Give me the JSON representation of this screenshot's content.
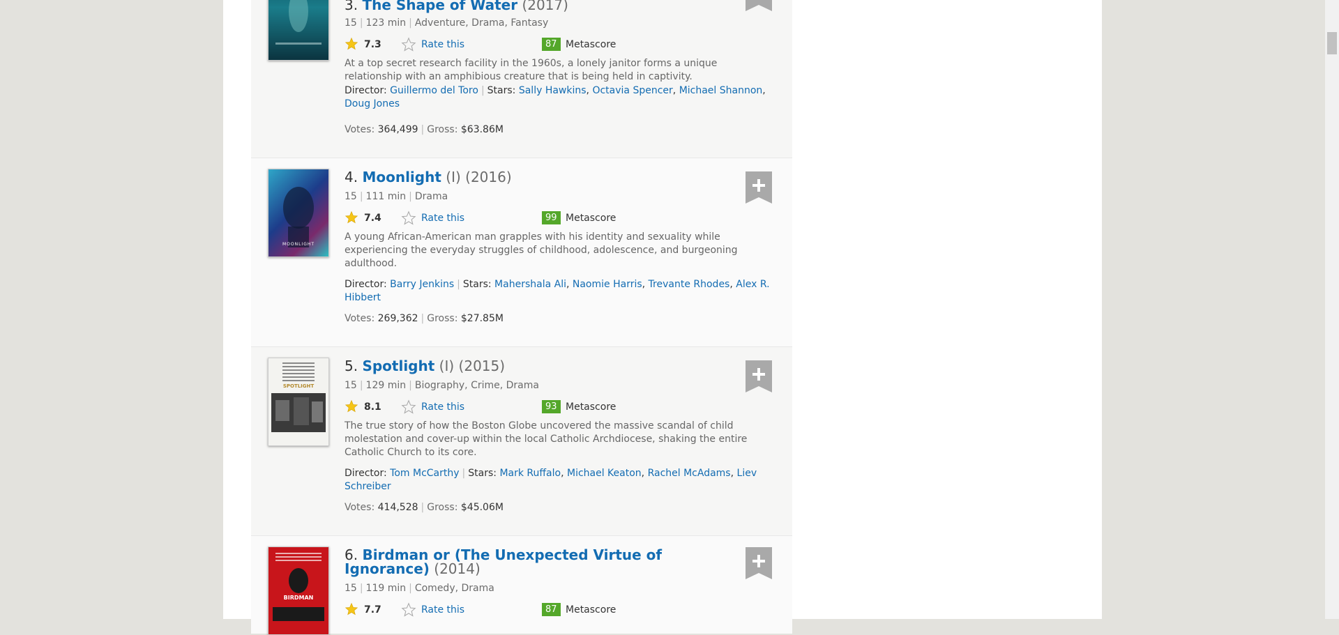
{
  "colors": {
    "link": "#136cb2",
    "metascore_green": "#54a72a",
    "page_bg": "#e3e2dd"
  },
  "movies": [
    {
      "index": "3.",
      "title": "The Shape of Water",
      "year": "(2017)",
      "extra": "",
      "cert": "15",
      "runtime": "123 min",
      "genres": "Adventure, Drama, Fantasy",
      "rating": "7.3",
      "rate_this": "Rate this",
      "metascore": "87",
      "metascore_label": "Metascore",
      "description": "At a top secret research facility in the 1960s, a lonely janitor forms a unique relationship with an amphibious creature that is being held in captivity.",
      "director_label": "Director:",
      "director": "Guillermo del Toro",
      "stars_label": "Stars:",
      "stars": [
        "Sally Hawkins",
        "Octavia Spencer",
        "Michael Shannon",
        "Doug Jones"
      ],
      "votes_label": "Votes:",
      "votes": "364,499",
      "gross_label": "Gross:",
      "gross": "$63.86M"
    },
    {
      "index": "4.",
      "title": "Moonlight",
      "year": "(2016)",
      "extra": "(I)",
      "cert": "15",
      "runtime": "111 min",
      "genres": "Drama",
      "rating": "7.4",
      "rate_this": "Rate this",
      "metascore": "99",
      "metascore_label": "Metascore",
      "description": "A young African-American man grapples with his identity and sexuality while experiencing the everyday struggles of childhood, adolescence, and burgeoning adulthood.",
      "director_label": "Director:",
      "director": "Barry Jenkins",
      "stars_label": "Stars:",
      "stars": [
        "Mahershala Ali",
        "Naomie Harris",
        "Trevante Rhodes",
        "Alex R. Hibbert"
      ],
      "votes_label": "Votes:",
      "votes": "269,362",
      "gross_label": "Gross:",
      "gross": "$27.85M",
      "poster_text": "MOONLIGHT"
    },
    {
      "index": "5.",
      "title": "Spotlight",
      "year": "(2015)",
      "extra": "(I)",
      "cert": "15",
      "runtime": "129 min",
      "genres": "Biography, Crime, Drama",
      "rating": "8.1",
      "rate_this": "Rate this",
      "metascore": "93",
      "metascore_label": "Metascore",
      "description": "The true story of how the Boston Globe uncovered the massive scandal of child molestation and cover-up within the local Catholic Archdiocese, shaking the entire Catholic Church to its core.",
      "director_label": "Director:",
      "director": "Tom McCarthy",
      "stars_label": "Stars:",
      "stars": [
        "Mark Ruffalo",
        "Michael Keaton",
        "Rachel McAdams",
        "Liev Schreiber"
      ],
      "votes_label": "Votes:",
      "votes": "414,528",
      "gross_label": "Gross:",
      "gross": "$45.06M",
      "poster_text": "SPOTLIGHT"
    },
    {
      "index": "6.",
      "title": "Birdman or (The Unexpected Virtue of Ignorance)",
      "year": "(2014)",
      "extra": "",
      "cert": "15",
      "runtime": "119 min",
      "genres": "Comedy, Drama",
      "rating": "7.7",
      "rate_this": "Rate this",
      "metascore": "87",
      "metascore_label": "Metascore",
      "poster_text": "BIRDMAN"
    }
  ]
}
